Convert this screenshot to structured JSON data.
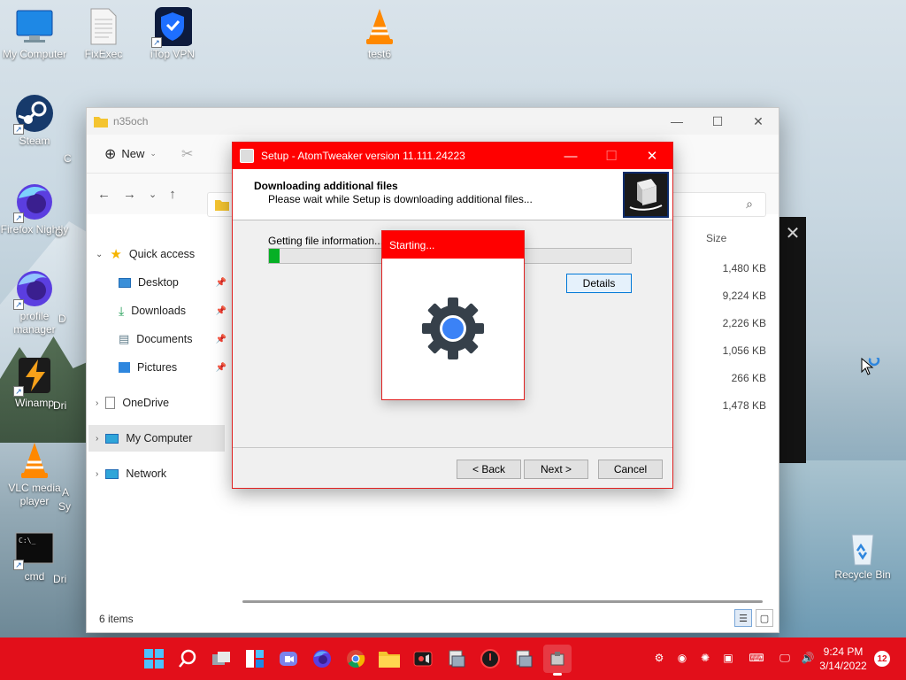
{
  "desktop": {
    "icons": [
      {
        "label": "My Computer"
      },
      {
        "label": "FixExec"
      },
      {
        "label": "iTop VPN"
      },
      {
        "label": "test6"
      },
      {
        "label": "Steam"
      },
      {
        "label": "Firefox Nightly"
      },
      {
        "label": "profile manager"
      },
      {
        "label": "Winamp"
      },
      {
        "label": "VLC media player"
      },
      {
        "label": "cmd"
      },
      {
        "label": "Recycle Bin"
      }
    ],
    "partial_labels": [
      "O",
      "D",
      "Dri",
      "A",
      "Sy",
      "Dri",
      "C"
    ]
  },
  "explorer": {
    "title": "n35och",
    "new_label": "New",
    "sidebar": [
      {
        "label": "Quick access"
      },
      {
        "label": "Desktop"
      },
      {
        "label": "Downloads"
      },
      {
        "label": "Documents"
      },
      {
        "label": "Pictures"
      },
      {
        "label": "OneDrive"
      },
      {
        "label": "My Computer"
      },
      {
        "label": "Network"
      }
    ],
    "size_header": "Size",
    "sizes": [
      "1,480 KB",
      "9,224 KB",
      "2,226 KB",
      "1,056 KB",
      "266 KB",
      "1,478 KB"
    ],
    "status": "6 items"
  },
  "setup": {
    "title": "Setup - AtomTweaker version 11.111.24223",
    "heading": "Downloading additional files",
    "subheading": "Please wait while Setup is downloading additional files...",
    "status_text": "Getting file information...",
    "progress": 0.03,
    "details_label": "Details",
    "back_label": "< Back",
    "next_label": "Next >",
    "cancel_label": "Cancel"
  },
  "starting_popup": {
    "title": "Starting..."
  },
  "taskbar": {
    "time": "9:24 PM",
    "date": "3/14/2022",
    "notification_count": "12"
  },
  "colors": {
    "taskbar": "#e20f1a",
    "setup_titlebar": "#ff0000",
    "progress_fill": "#06b025",
    "gear_center": "#3b82f6"
  }
}
